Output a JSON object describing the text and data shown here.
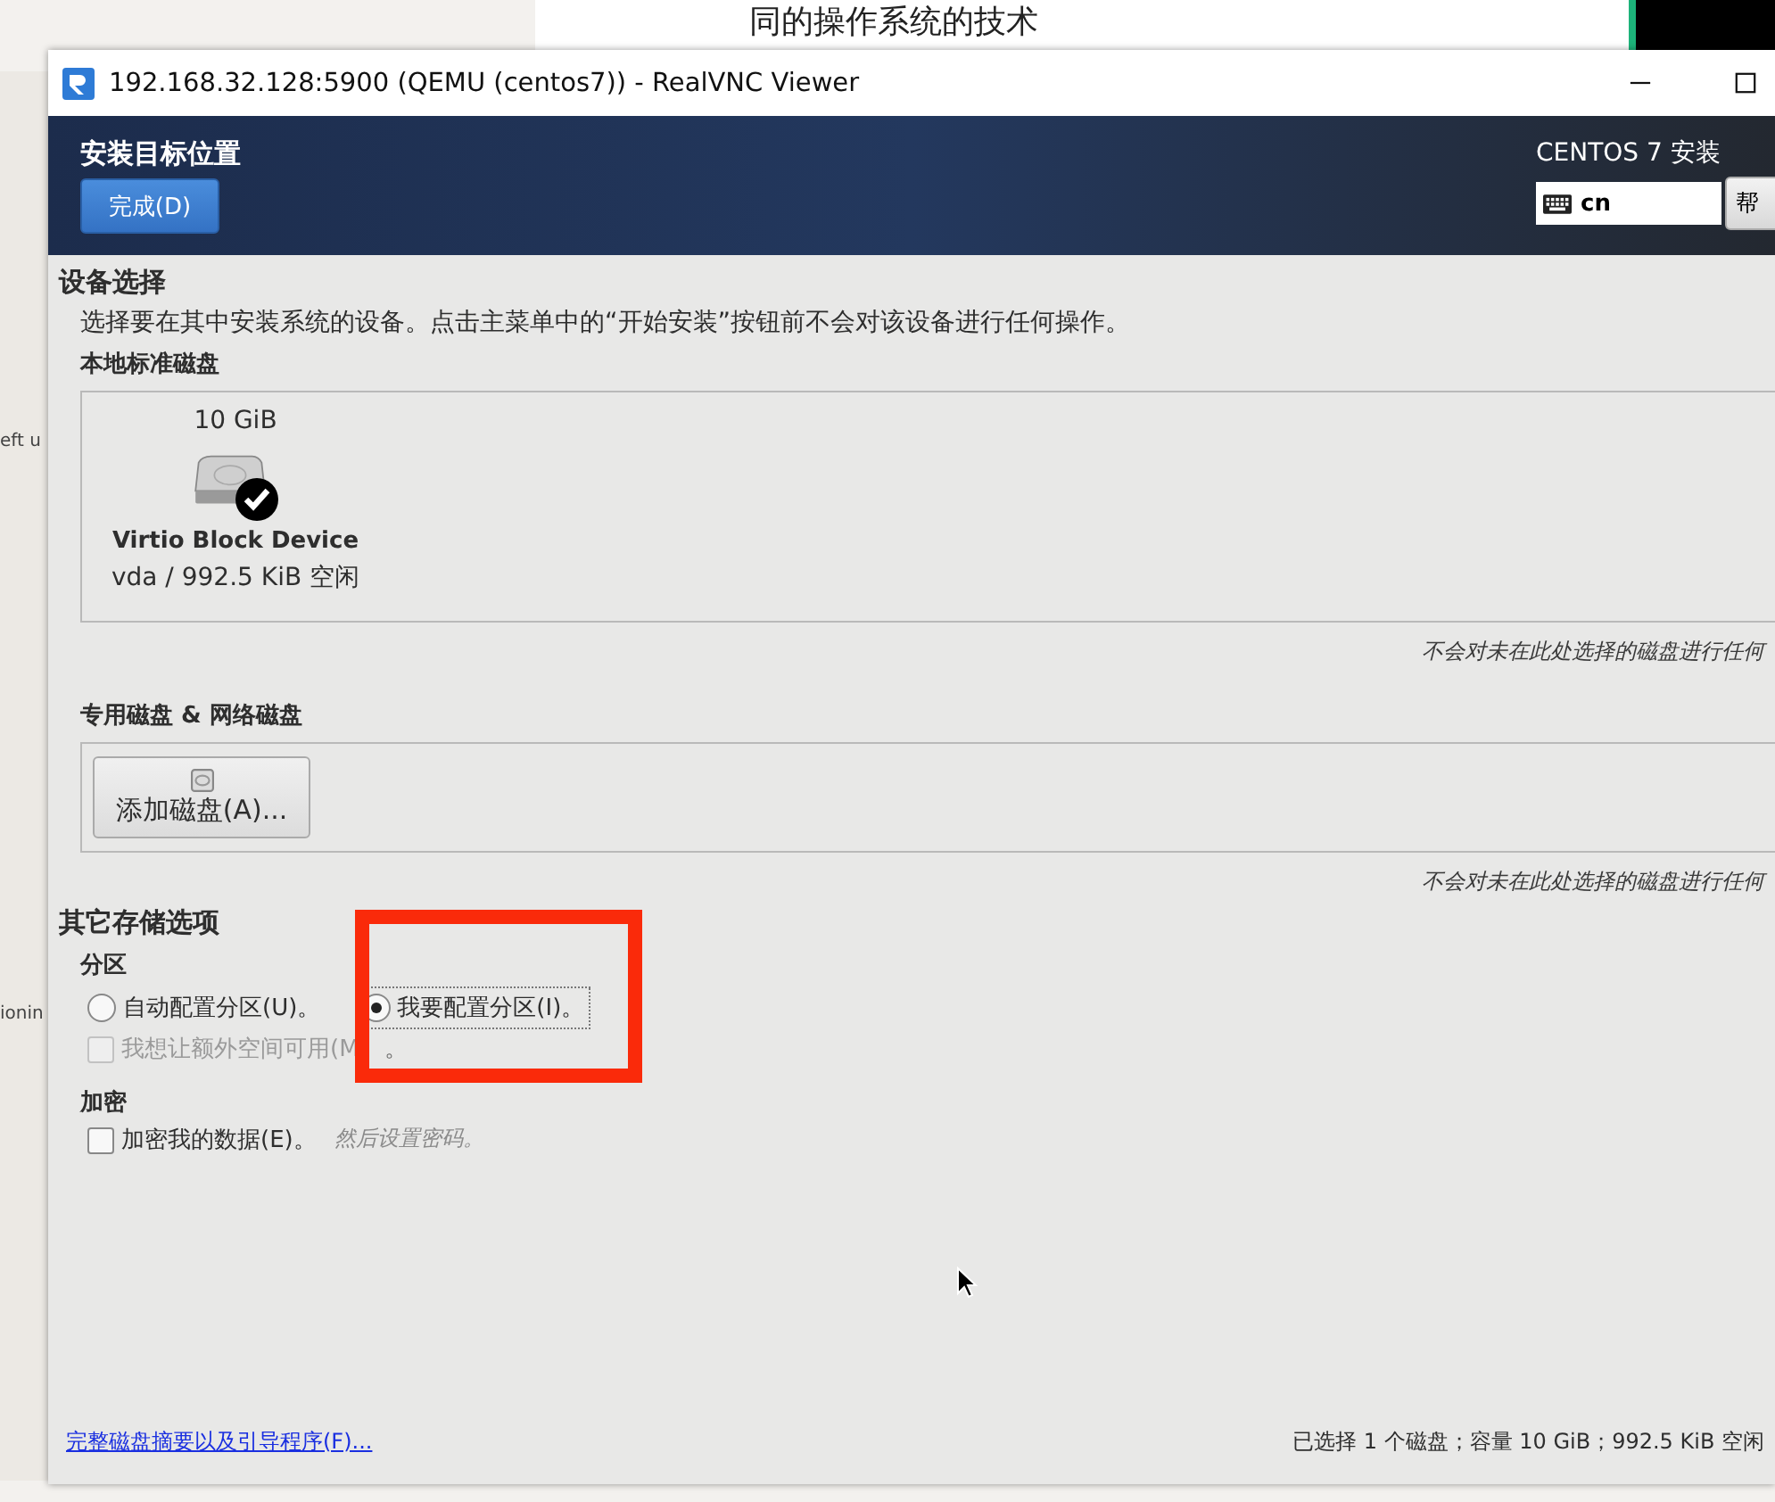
{
  "background": {
    "document_text": "同的操作系统的技术",
    "side_texts": [
      "eft u",
      "ionin"
    ]
  },
  "window": {
    "title": "192.168.32.128:5900 (QEMU (centos7)) - RealVNC Viewer"
  },
  "header": {
    "title": "安装目标位置",
    "done_button": "完成(D)",
    "product": "CENTOS 7 安装",
    "keyboard": "cn",
    "help_button": "帮"
  },
  "device_selection": {
    "heading": "设备选择",
    "description": "选择要在其中安装系统的设备。点击主菜单中的“开始安装”按钮前不会对该设备进行任何操作。",
    "local_label": "本地标准磁盘",
    "disks": [
      {
        "size": "10 GiB",
        "name": "Virtio Block Device",
        "detail": "vda / 992.5 KiB 空闲",
        "selected": true
      }
    ],
    "local_note": "不会对未在此处选择的磁盘进行任何",
    "specialized_label": "专用磁盘 & 网络磁盘",
    "add_disk_button": "添加磁盘(A)...",
    "specialized_note": "不会对未在此处选择的磁盘进行任何"
  },
  "other_options": {
    "heading": "其它存储选项",
    "partitioning_label": "分区",
    "partition_options": [
      {
        "label": "自动配置分区(U)。",
        "selected": false
      },
      {
        "label": "我要配置分区(I)。",
        "selected": true
      }
    ],
    "extra_space": {
      "label": "我想让额外空间可用(M",
      "label_tail": "。",
      "checked": false,
      "disabled": true
    },
    "encryption_label": "加密",
    "encrypt": {
      "label": "加密我的数据(E)。",
      "checked": false,
      "hint": "然后设置密码。"
    }
  },
  "footer": {
    "link": "完整磁盘摘要以及引导程序(F)...",
    "status": "已选择 1 个磁盘；容量 10 GiB；992.5 KiB 空闲"
  }
}
